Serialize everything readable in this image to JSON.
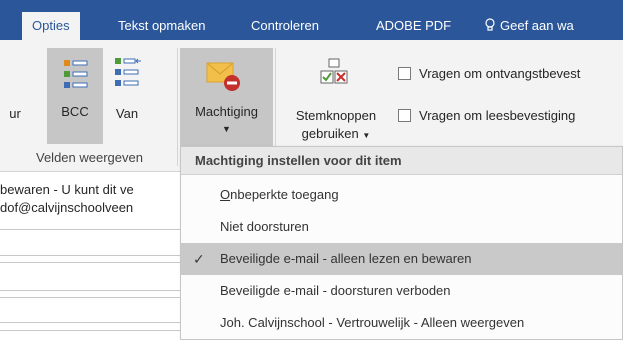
{
  "tabs": [
    {
      "label": "Opties",
      "active": true
    },
    {
      "label": "Tekst opmaken"
    },
    {
      "label": "Controleren"
    },
    {
      "label": "ADOBE PDF"
    },
    {
      "label": "Geef aan wa"
    }
  ],
  "ribbon": {
    "partial_left_label": "ur",
    "bcc_label": "BCC",
    "van_label": "Van",
    "group_velden": "Velden weergeven",
    "machtiging_label": "Machtiging",
    "stemknoppen_line1": "Stemknoppen",
    "stemknoppen_line2": "gebruiken",
    "check_ontvangst": "Vragen om ontvangstbevest",
    "check_lees": "Vragen om leesbevestiging"
  },
  "message": {
    "line1": "bewaren - U kunt dit ve",
    "line2": "dof@calvijnschoolveen"
  },
  "dropdown": {
    "header": "Machtiging instellen voor dit item",
    "items": [
      {
        "mnemonic": "O",
        "rest": "nbeperkte toegang",
        "checked": false
      },
      {
        "label": "Niet doorsturen",
        "checked": false
      },
      {
        "label": "Beveiligde e-mail - alleen lezen en bewaren",
        "checked": true
      },
      {
        "label": "Beveiligde e-mail - doorsturen verboden",
        "checked": false
      },
      {
        "label": "Joh. Calvijnschool - Vertrouwelijk - Alleen weergeven",
        "checked": false
      }
    ],
    "check_glyph": "✓"
  },
  "colors": {
    "tabbar": "#2b579a",
    "ribbon": "#f3f3f3",
    "selected": "#c9c9c9"
  }
}
